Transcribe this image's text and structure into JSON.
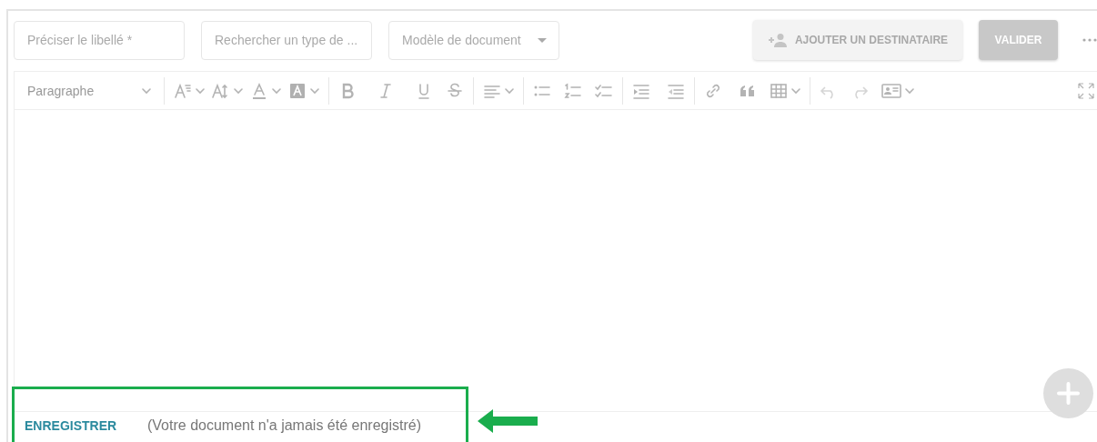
{
  "header": {
    "fields": [
      {
        "kind": "text",
        "placeholder": "Préciser le libellé *"
      },
      {
        "kind": "text",
        "placeholder": "Rechercher un type de ..."
      },
      {
        "kind": "select",
        "placeholder": "Modèle de document"
      }
    ],
    "buttons": [
      {
        "kind": "outlined",
        "label": "AJOUTER UN DESTINATAIRE",
        "disabled": true
      },
      {
        "kind": "filled",
        "label": "VALIDER",
        "disabled": true
      }
    ]
  },
  "toolbar": {
    "block_style": "Paragraphe"
  },
  "footer": {
    "save_link": "ENREGISTRER",
    "status": "(Votre document n'a jamais été enregistré)"
  }
}
